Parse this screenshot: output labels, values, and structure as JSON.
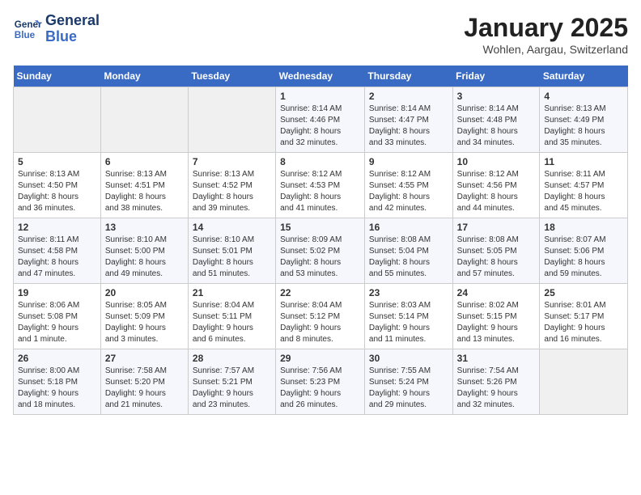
{
  "header": {
    "logo_line1": "General",
    "logo_line2": "Blue",
    "month": "January 2025",
    "location": "Wohlen, Aargau, Switzerland"
  },
  "days_of_week": [
    "Sunday",
    "Monday",
    "Tuesday",
    "Wednesday",
    "Thursday",
    "Friday",
    "Saturday"
  ],
  "weeks": [
    [
      {
        "day": "",
        "info": ""
      },
      {
        "day": "",
        "info": ""
      },
      {
        "day": "",
        "info": ""
      },
      {
        "day": "1",
        "info": "Sunrise: 8:14 AM\nSunset: 4:46 PM\nDaylight: 8 hours\nand 32 minutes."
      },
      {
        "day": "2",
        "info": "Sunrise: 8:14 AM\nSunset: 4:47 PM\nDaylight: 8 hours\nand 33 minutes."
      },
      {
        "day": "3",
        "info": "Sunrise: 8:14 AM\nSunset: 4:48 PM\nDaylight: 8 hours\nand 34 minutes."
      },
      {
        "day": "4",
        "info": "Sunrise: 8:13 AM\nSunset: 4:49 PM\nDaylight: 8 hours\nand 35 minutes."
      }
    ],
    [
      {
        "day": "5",
        "info": "Sunrise: 8:13 AM\nSunset: 4:50 PM\nDaylight: 8 hours\nand 36 minutes."
      },
      {
        "day": "6",
        "info": "Sunrise: 8:13 AM\nSunset: 4:51 PM\nDaylight: 8 hours\nand 38 minutes."
      },
      {
        "day": "7",
        "info": "Sunrise: 8:13 AM\nSunset: 4:52 PM\nDaylight: 8 hours\nand 39 minutes."
      },
      {
        "day": "8",
        "info": "Sunrise: 8:12 AM\nSunset: 4:53 PM\nDaylight: 8 hours\nand 41 minutes."
      },
      {
        "day": "9",
        "info": "Sunrise: 8:12 AM\nSunset: 4:55 PM\nDaylight: 8 hours\nand 42 minutes."
      },
      {
        "day": "10",
        "info": "Sunrise: 8:12 AM\nSunset: 4:56 PM\nDaylight: 8 hours\nand 44 minutes."
      },
      {
        "day": "11",
        "info": "Sunrise: 8:11 AM\nSunset: 4:57 PM\nDaylight: 8 hours\nand 45 minutes."
      }
    ],
    [
      {
        "day": "12",
        "info": "Sunrise: 8:11 AM\nSunset: 4:58 PM\nDaylight: 8 hours\nand 47 minutes."
      },
      {
        "day": "13",
        "info": "Sunrise: 8:10 AM\nSunset: 5:00 PM\nDaylight: 8 hours\nand 49 minutes."
      },
      {
        "day": "14",
        "info": "Sunrise: 8:10 AM\nSunset: 5:01 PM\nDaylight: 8 hours\nand 51 minutes."
      },
      {
        "day": "15",
        "info": "Sunrise: 8:09 AM\nSunset: 5:02 PM\nDaylight: 8 hours\nand 53 minutes."
      },
      {
        "day": "16",
        "info": "Sunrise: 8:08 AM\nSunset: 5:04 PM\nDaylight: 8 hours\nand 55 minutes."
      },
      {
        "day": "17",
        "info": "Sunrise: 8:08 AM\nSunset: 5:05 PM\nDaylight: 8 hours\nand 57 minutes."
      },
      {
        "day": "18",
        "info": "Sunrise: 8:07 AM\nSunset: 5:06 PM\nDaylight: 8 hours\nand 59 minutes."
      }
    ],
    [
      {
        "day": "19",
        "info": "Sunrise: 8:06 AM\nSunset: 5:08 PM\nDaylight: 9 hours\nand 1 minute."
      },
      {
        "day": "20",
        "info": "Sunrise: 8:05 AM\nSunset: 5:09 PM\nDaylight: 9 hours\nand 3 minutes."
      },
      {
        "day": "21",
        "info": "Sunrise: 8:04 AM\nSunset: 5:11 PM\nDaylight: 9 hours\nand 6 minutes."
      },
      {
        "day": "22",
        "info": "Sunrise: 8:04 AM\nSunset: 5:12 PM\nDaylight: 9 hours\nand 8 minutes."
      },
      {
        "day": "23",
        "info": "Sunrise: 8:03 AM\nSunset: 5:14 PM\nDaylight: 9 hours\nand 11 minutes."
      },
      {
        "day": "24",
        "info": "Sunrise: 8:02 AM\nSunset: 5:15 PM\nDaylight: 9 hours\nand 13 minutes."
      },
      {
        "day": "25",
        "info": "Sunrise: 8:01 AM\nSunset: 5:17 PM\nDaylight: 9 hours\nand 16 minutes."
      }
    ],
    [
      {
        "day": "26",
        "info": "Sunrise: 8:00 AM\nSunset: 5:18 PM\nDaylight: 9 hours\nand 18 minutes."
      },
      {
        "day": "27",
        "info": "Sunrise: 7:58 AM\nSunset: 5:20 PM\nDaylight: 9 hours\nand 21 minutes."
      },
      {
        "day": "28",
        "info": "Sunrise: 7:57 AM\nSunset: 5:21 PM\nDaylight: 9 hours\nand 23 minutes."
      },
      {
        "day": "29",
        "info": "Sunrise: 7:56 AM\nSunset: 5:23 PM\nDaylight: 9 hours\nand 26 minutes."
      },
      {
        "day": "30",
        "info": "Sunrise: 7:55 AM\nSunset: 5:24 PM\nDaylight: 9 hours\nand 29 minutes."
      },
      {
        "day": "31",
        "info": "Sunrise: 7:54 AM\nSunset: 5:26 PM\nDaylight: 9 hours\nand 32 minutes."
      },
      {
        "day": "",
        "info": ""
      }
    ]
  ]
}
